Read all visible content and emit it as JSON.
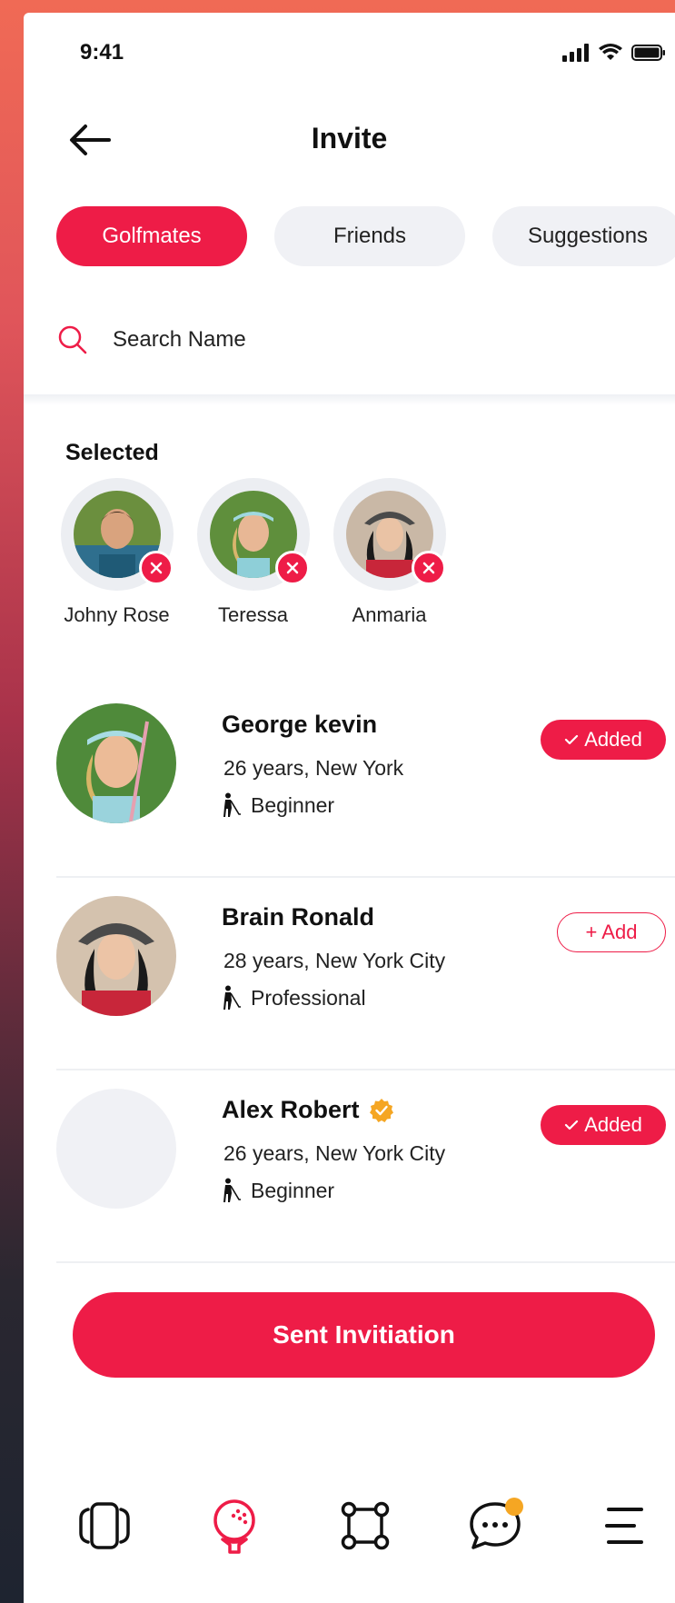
{
  "status_bar": {
    "time": "9:41"
  },
  "header": {
    "title": "Invite"
  },
  "tabs": [
    {
      "label": "Golfmates",
      "active": true
    },
    {
      "label": "Friends",
      "active": false
    },
    {
      "label": "Suggestions",
      "active": false
    }
  ],
  "search": {
    "placeholder": "Search Name"
  },
  "selected": {
    "label": "Selected",
    "items": [
      {
        "name": "Johny Rose"
      },
      {
        "name": "Teressa"
      },
      {
        "name": "Anmaria"
      }
    ]
  },
  "users": [
    {
      "name": "George kevin",
      "meta": "26 years, New York",
      "level": "Beginner",
      "status": "Added",
      "verified": false
    },
    {
      "name": "Brain Ronald",
      "meta": "28 years, New York City",
      "level": "Professional",
      "status": "+ Add",
      "verified": false
    },
    {
      "name": "Alex Robert",
      "meta": "26 years, New York City",
      "level": "Beginner",
      "status": "Added",
      "verified": true
    }
  ],
  "cta": {
    "label": "Sent Invitiation"
  },
  "colors": {
    "accent": "#ee1c47",
    "chip_bg": "#f0f1f5",
    "badge": "#f5a623"
  },
  "bottom_nav": [
    {
      "icon": "cards-icon",
      "active": false
    },
    {
      "icon": "golf-ball-icon",
      "active": true
    },
    {
      "icon": "network-icon",
      "active": false
    },
    {
      "icon": "chat-icon",
      "active": false,
      "badge": true
    },
    {
      "icon": "menu-icon",
      "active": false
    }
  ]
}
